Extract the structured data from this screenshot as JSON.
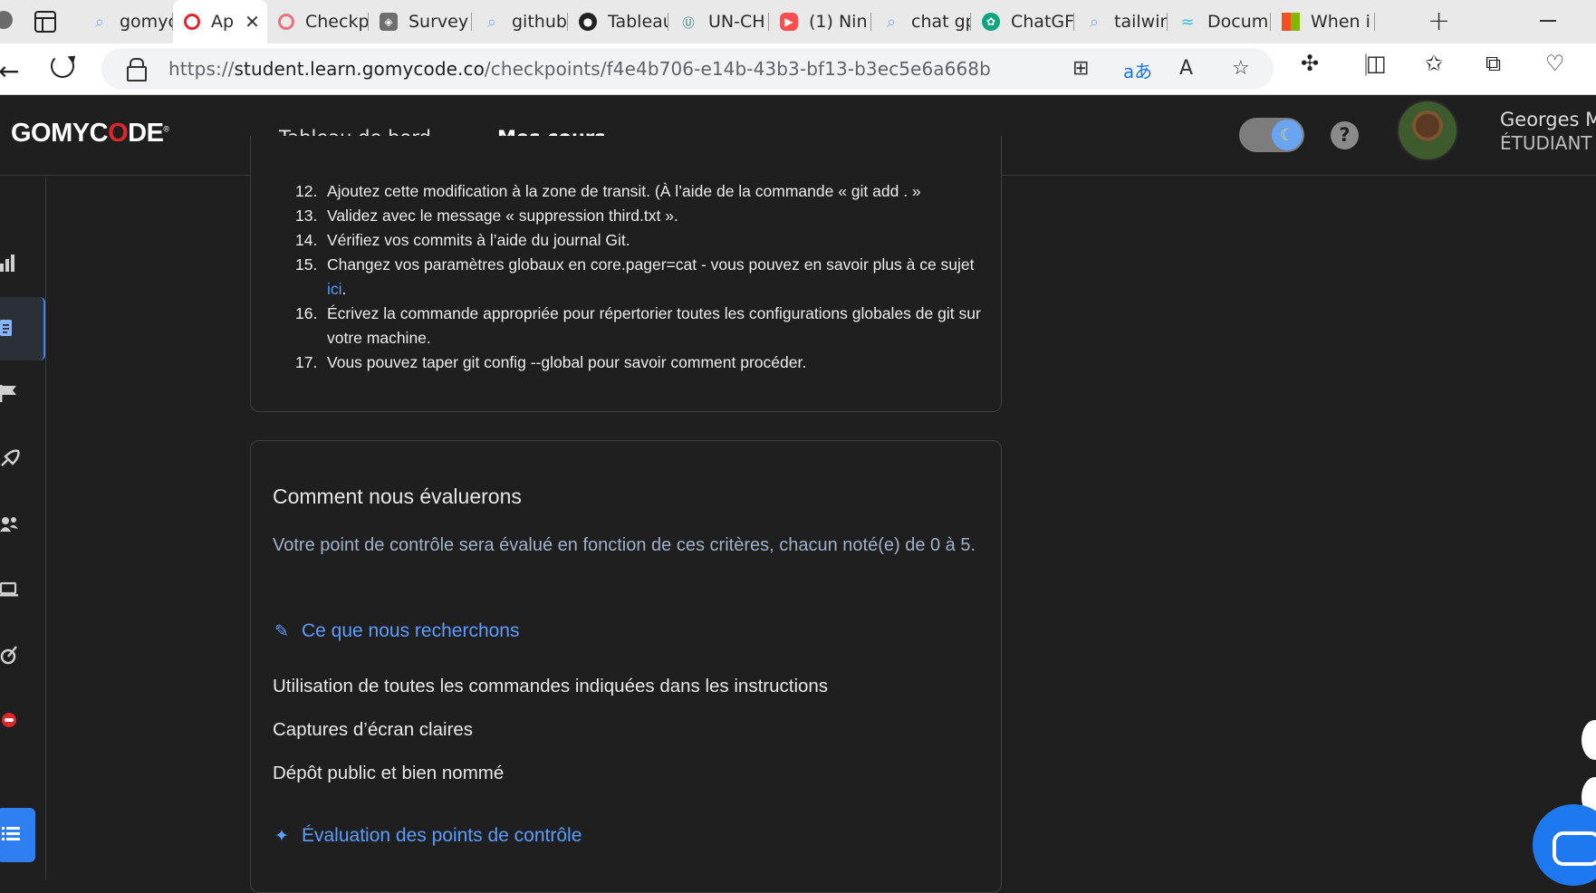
{
  "browser": {
    "tabs": [
      {
        "label": "gomyco",
        "icon": "search-icon",
        "color": "#8ab4f8"
      },
      {
        "label": "Ap",
        "icon": "gomycode-favicon",
        "color": "#e0262d",
        "active": true
      },
      {
        "label": "Checkp",
        "icon": "gomycode-favicon",
        "color": "#e0262d"
      },
      {
        "label": "Survey",
        "icon": "survey-icon",
        "color": "#6e6e6e"
      },
      {
        "label": "github",
        "icon": "search-icon",
        "color": "#8ab4f8"
      },
      {
        "label": "Tableau",
        "icon": "github-icon",
        "color": "#222222"
      },
      {
        "label": "UN-CH",
        "icon": "un-icon",
        "color": "#9cc2b9"
      },
      {
        "label": "(1) Nin",
        "icon": "youtube-icon",
        "color": "#ff0000"
      },
      {
        "label": "chat gp",
        "icon": "search-icon",
        "color": "#8ab4f8"
      },
      {
        "label": "ChatGF",
        "icon": "chatgpt-icon",
        "color": "#10a37f"
      },
      {
        "label": "tailwin",
        "icon": "search-icon",
        "color": "#8ab4f8"
      },
      {
        "label": "Docum",
        "icon": "tailwind-icon",
        "color": "#38bdf8"
      },
      {
        "label": "When i",
        "icon": "microsoft-icon",
        "color": "#f25022"
      }
    ],
    "url_prefix": "https://",
    "url_host": "student.learn.gomycode.co",
    "url_path": "/checkpoints/f4e4b706-e14b-43b3-bf13-b3ec5e6a668b"
  },
  "header": {
    "logo": {
      "part1": "GOMYC",
      "o": "O",
      "part2": "DE",
      "mark": "®"
    },
    "nav": [
      "Tableau de bord",
      "Mes cours"
    ],
    "user_name": "Georges M",
    "user_role": "ÉTUDIANT"
  },
  "instructions": [
    {
      "num": "12.",
      "text": "Ajoutez cette modification à la zone de transit. (À l’aide de la commande « git add . »"
    },
    {
      "num": "13.",
      "text": "Validez avec le message « suppression third.txt »."
    },
    {
      "num": "14.",
      "text": "Vérifiez vos commits à l’aide du journal Git."
    },
    {
      "num": "15.",
      "text_before": "Changez vos paramètres globaux en core.pager=cat - vous pouvez en savoir plus à ce sujet ",
      "link": "ici",
      "text_after": "."
    },
    {
      "num": "16.",
      "text": "Écrivez la commande appropriée pour répertorier toutes les configurations globales de git sur votre machine."
    },
    {
      "num": "17.",
      "text": "Vous pouvez taper git config --global pour savoir comment procéder."
    }
  ],
  "evaluation": {
    "title": "Comment nous évaluerons",
    "description": "Votre point de contrôle sera évalué en fonction de ces critères, chacun noté(e) de 0 à 5.",
    "looking_for": "Ce que nous recherchons",
    "criteria": [
      "Utilisation de toutes les commandes indiquées dans les instructions",
      "Captures d’écran claires",
      "Dépôt public et bien nommé"
    ],
    "checkpoint_eval": "Évaluation des points de contrôle"
  },
  "colors": {
    "accent": "#5b9cff",
    "brand_red": "#e0262d",
    "background": "#1f1f1f"
  }
}
